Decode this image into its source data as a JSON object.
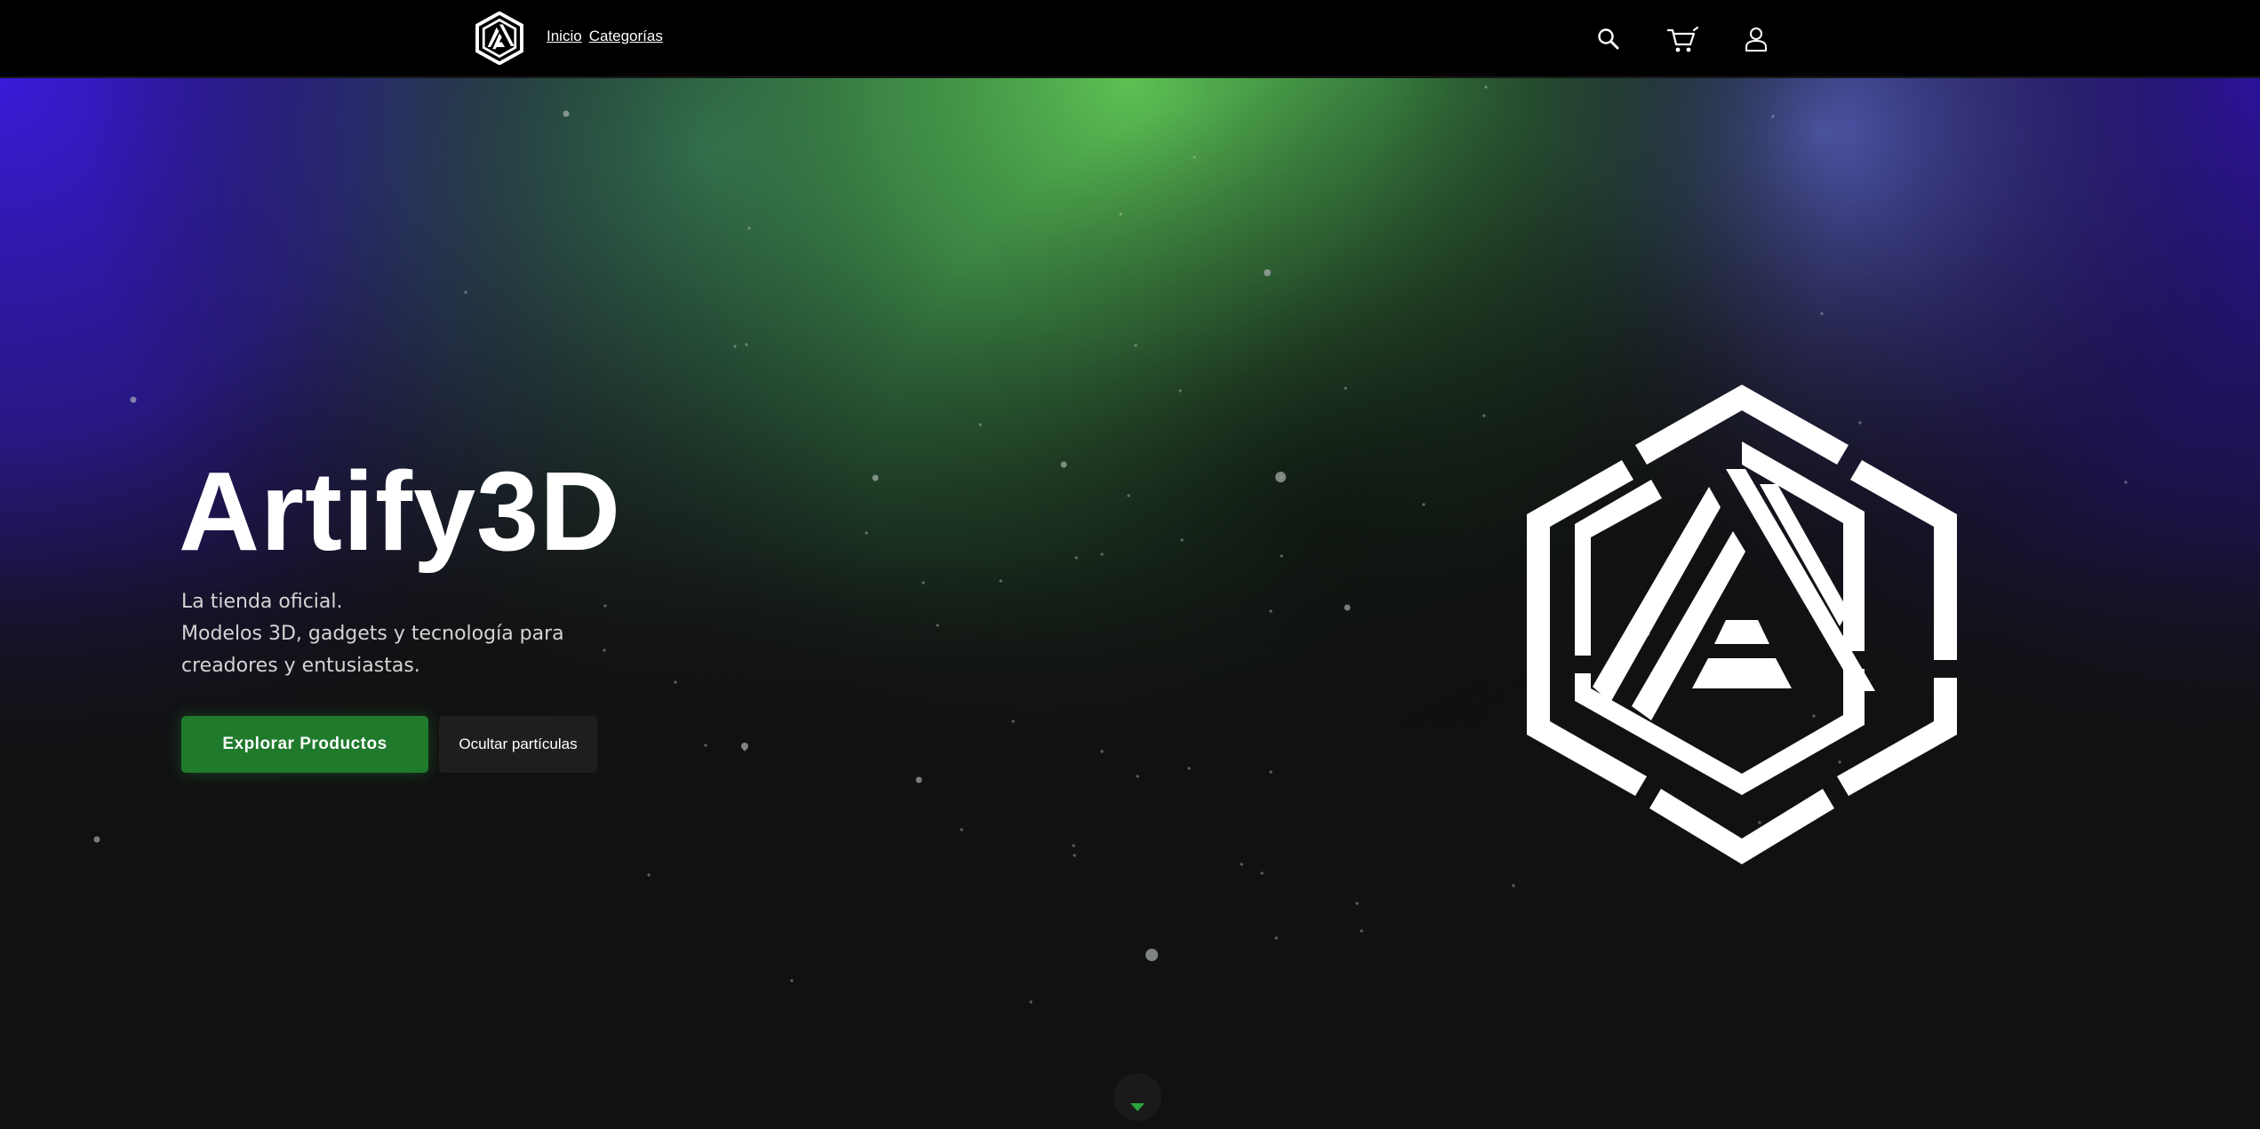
{
  "header": {
    "logo_icon": "artify3d-logo-icon",
    "nav": [
      {
        "label": "Inicio"
      },
      {
        "label": "Categorías"
      }
    ],
    "icons": [
      "search-icon",
      "cart-icon",
      "user-icon"
    ]
  },
  "hero": {
    "title": "Artify3D",
    "tagline_line1": "La tienda oficial.",
    "tagline_line2": "Modelos 3D, gadgets y tecnología para creadores y entusiastas.",
    "primary_button": "Explorar Productos",
    "secondary_button": "Ocultar partículas",
    "logo_icon": "artify3d-logo-icon",
    "scroll_icon": "chevron-down-icon"
  },
  "colors": {
    "header_bg": "#000000",
    "page_bg": "#111111",
    "aurora_green": "#5cc153",
    "aurora_purple": "#3a1ad8",
    "primary_button": "#1f7a2c",
    "secondary_button": "#1e1e1e"
  }
}
